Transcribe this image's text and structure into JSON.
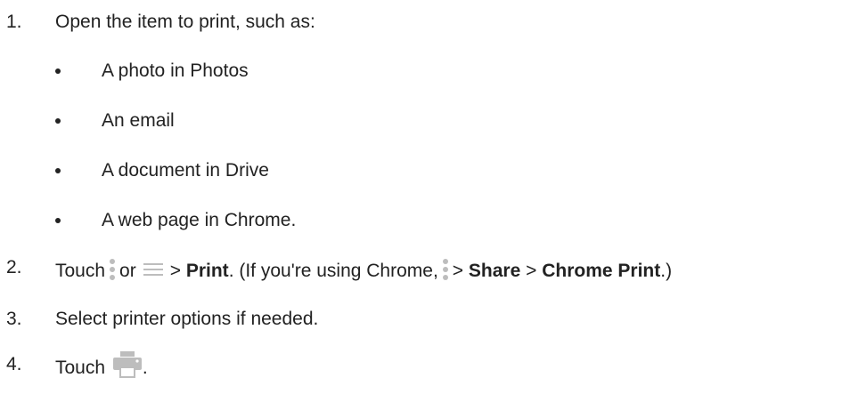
{
  "steps": [
    {
      "num": "1.",
      "text": "Open the item to print, such as:"
    },
    {
      "num": "2.",
      "before": "Touch",
      "or": "or",
      "gt1": ">",
      "print_label": "Print",
      "paren_open": ". (If you're using Chrome,",
      "gt2": ">",
      "share_label": "Share",
      "gt3": ">",
      "chrome_print_label": "Chrome Print",
      "paren_close": ".)"
    },
    {
      "num": "3.",
      "text": "Select printer options if needed."
    },
    {
      "num": "4.",
      "before": "Touch",
      "after": "."
    }
  ],
  "examples": [
    "A photo in Photos",
    "An email",
    "A document in Drive",
    "A web page in Chrome."
  ],
  "icons": {
    "more": "more-vert-icon",
    "menu": "menu-icon",
    "print": "print-icon",
    "icon_color": "#bdbdbd"
  }
}
